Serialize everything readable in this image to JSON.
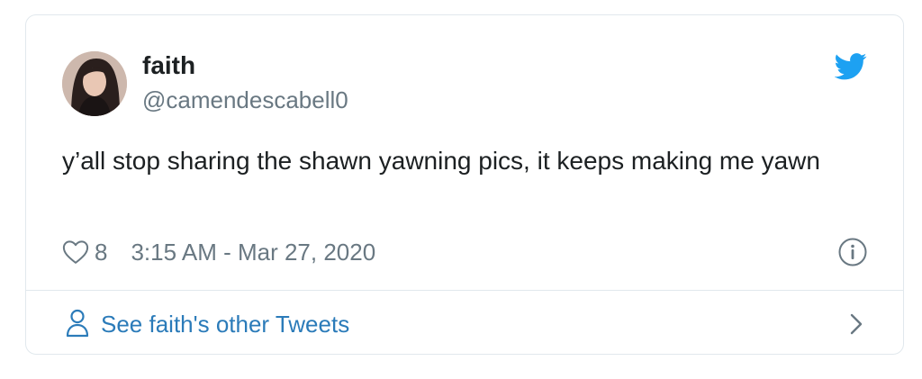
{
  "tweet": {
    "display_name": "faith",
    "handle": "@camendescabell0",
    "text": "y’all stop sharing the shawn yawning pics, it keeps making me yawn",
    "like_count": "8",
    "timestamp": "3:15 AM - Mar 27, 2020"
  },
  "footer": {
    "more_tweets_label": "See faith's other Tweets"
  },
  "icons": {
    "brand": "twitter-bird-icon",
    "like": "heart-outline-icon",
    "info": "info-circle-icon",
    "profile": "person-icon",
    "navigate": "chevron-right-icon"
  },
  "colors": {
    "brand_blue": "#1da1f2",
    "link_blue": "#2b7bb9",
    "muted_text": "#697882",
    "primary_text": "#1c2022",
    "border": "#e1e8ed"
  }
}
